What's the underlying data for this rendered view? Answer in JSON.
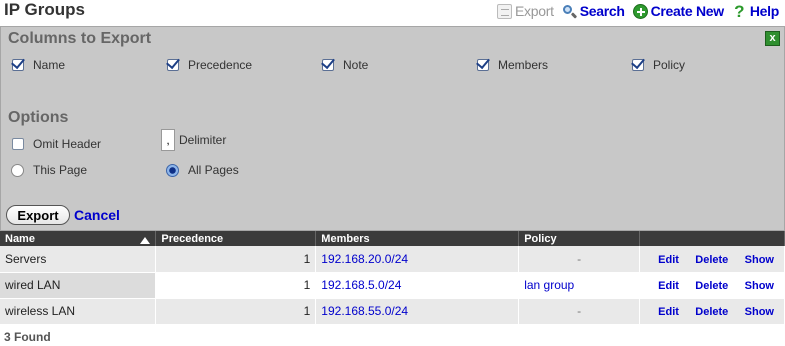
{
  "page": {
    "title": "IP Groups"
  },
  "toolbar": {
    "export_label": "Export",
    "search_label": "Search",
    "create_label": "Create New",
    "help_label": "Help"
  },
  "export_panel": {
    "close_label": "x",
    "columns_heading": "Columns to Export",
    "columns": [
      {
        "label": "Name",
        "checked": true
      },
      {
        "label": "Precedence",
        "checked": true
      },
      {
        "label": "Note",
        "checked": true
      },
      {
        "label": "Members",
        "checked": true
      },
      {
        "label": "Policy",
        "checked": true
      }
    ],
    "options_heading": "Options",
    "omit_header_label": "Omit Header",
    "omit_header_checked": false,
    "delimiter_label": "Delimiter",
    "delimiter_value": ",",
    "this_page_label": "This Page",
    "all_pages_label": "All Pages",
    "selected_scope": "All Pages",
    "export_button": "Export",
    "cancel_link": "Cancel"
  },
  "table": {
    "headers": {
      "name": "Name",
      "precedence": "Precedence",
      "members": "Members",
      "policy": "Policy"
    },
    "sorted_by": "Name",
    "sort_direction": "ascending",
    "row_actions": [
      "Edit",
      "Delete",
      "Show"
    ],
    "rows": [
      {
        "name": "Servers",
        "precedence": "1",
        "members": "192.168.20.0/24",
        "policy": "-"
      },
      {
        "name": "wired LAN",
        "precedence": "1",
        "members": "192.168.5.0/24",
        "policy": "lan group"
      },
      {
        "name": "wireless LAN",
        "precedence": "1",
        "members": "192.168.55.0/24",
        "policy": "-"
      }
    ]
  },
  "footer": {
    "found_text": "3 Found"
  },
  "colors": {
    "link": "#0000cc",
    "panel": "#c8c8c8",
    "header": "#3b3b3b",
    "create_icon": "#2e9a2e"
  }
}
